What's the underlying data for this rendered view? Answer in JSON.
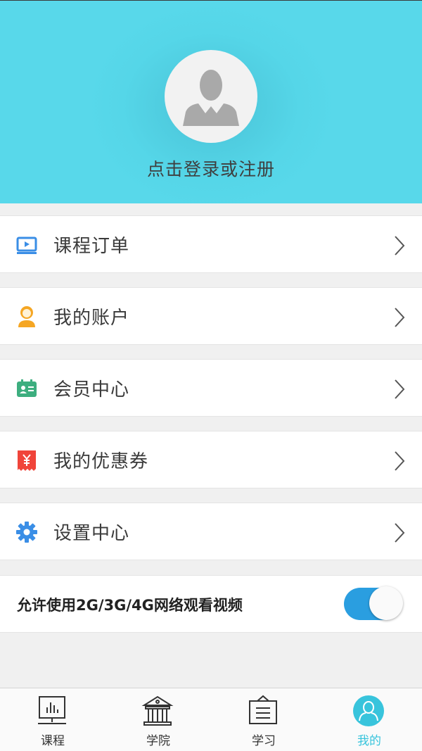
{
  "profile": {
    "login_text": "点击登录或注册"
  },
  "menu": [
    {
      "label": "课程订单",
      "icon": "course-order-icon"
    },
    {
      "label": "我的账户",
      "icon": "account-icon"
    },
    {
      "label": "会员中心",
      "icon": "member-card-icon"
    },
    {
      "label": "我的优惠券",
      "icon": "coupon-icon"
    },
    {
      "label": "设置中心",
      "icon": "gear-icon"
    }
  ],
  "settings": {
    "network_toggle_label": "允许使用2G/3G/4G网络观看视频",
    "network_toggle_on": true
  },
  "tabbar": {
    "items": [
      {
        "label": "课程",
        "icon": "chart-board-icon",
        "active": false
      },
      {
        "label": "学院",
        "icon": "academy-building-icon",
        "active": false
      },
      {
        "label": "学习",
        "icon": "notice-board-icon",
        "active": false
      },
      {
        "label": "我的",
        "icon": "user-icon",
        "active": true
      }
    ]
  },
  "colors": {
    "header_bg": "#55d6e8",
    "accent": "#38c4dc",
    "toggle_on": "#2a9ee0"
  }
}
